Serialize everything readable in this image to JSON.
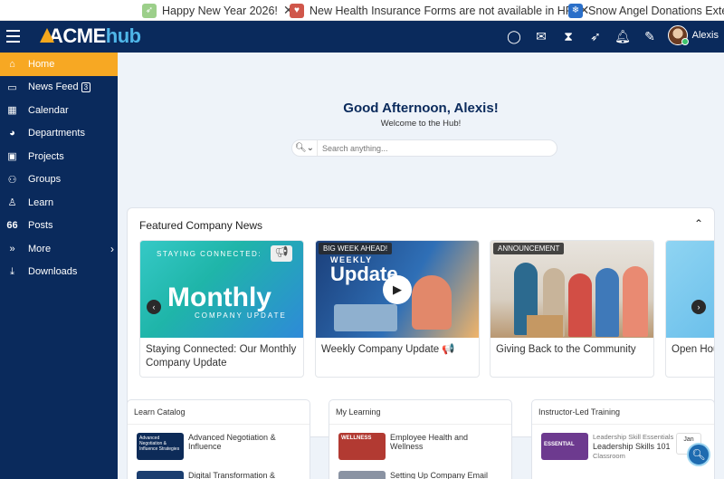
{
  "ticker": [
    {
      "text": "Happy New Year 2026!",
      "icon": "rocket-icon",
      "color": "#9ccf8a"
    },
    {
      "text": "New Health Insurance Forms are not available in HR",
      "icon": "heart-icon",
      "color": "#d0564a"
    },
    {
      "text": "Snow Angel Donations Extended",
      "icon": "snowflake-icon",
      "color": "#2a6fc9"
    }
  ],
  "header": {
    "logo_main": "ACME",
    "logo_accent": "hub",
    "user_name": "Alexis"
  },
  "sidebar": {
    "items": [
      {
        "label": "Home",
        "icon": "home-icon"
      },
      {
        "label": "News Feed",
        "icon": "news-icon",
        "badge": "3"
      },
      {
        "label": "Calendar",
        "icon": "calendar-icon"
      },
      {
        "label": "Departments",
        "icon": "departments-icon"
      },
      {
        "label": "Projects",
        "icon": "briefcase-icon"
      },
      {
        "label": "Groups",
        "icon": "groups-icon"
      },
      {
        "label": "Learn",
        "icon": "learn-icon"
      },
      {
        "label": "Posts",
        "icon": "quote-icon"
      },
      {
        "label": "More",
        "icon": "more-icon"
      },
      {
        "label": "Downloads",
        "icon": "download-icon"
      }
    ]
  },
  "main": {
    "greeting": "Good Afternoon, Alexis!",
    "subtitle": "Welcome to the Hub!",
    "search_placeholder": "Search anything..."
  },
  "featured": {
    "title": "Featured Company News",
    "cards": [
      {
        "caption": "Staying Connected: Our Monthly Company Update",
        "image_top": "STAYING CONNECTED:",
        "image_main": "Monthly",
        "image_sub": "COMPANY UPDATE"
      },
      {
        "caption": "Weekly Company Update 📢",
        "tag": "BIG WEEK AHEAD!",
        "image_top": "WEEKLY",
        "image_main": "Update"
      },
      {
        "caption": "Giving Back to the Community",
        "tag": "ANNOUNCEMENT"
      },
      {
        "caption": "Open Hou Update"
      }
    ]
  },
  "learn_catalog": {
    "title": "Learn Catalog",
    "items": [
      {
        "title": "Advanced Negotiation & Influence",
        "thumb": "Advanced Negotiation & Influence Strategies"
      },
      {
        "title": "Digital Transformation &"
      }
    ]
  },
  "my_learning": {
    "title": "My Learning",
    "items": [
      {
        "title": "Employee Health and Wellness",
        "thumb": "WELLNESS"
      },
      {
        "title": "Setting Up Company Email"
      }
    ]
  },
  "instructor_led": {
    "title": "Instructor-Led Training",
    "item": {
      "kicker": "Leadership Skill Essentials",
      "title": "Leadership Skills 101",
      "type": "Classroom",
      "thumb": "ESSENTIAL",
      "date": "Jan"
    }
  }
}
